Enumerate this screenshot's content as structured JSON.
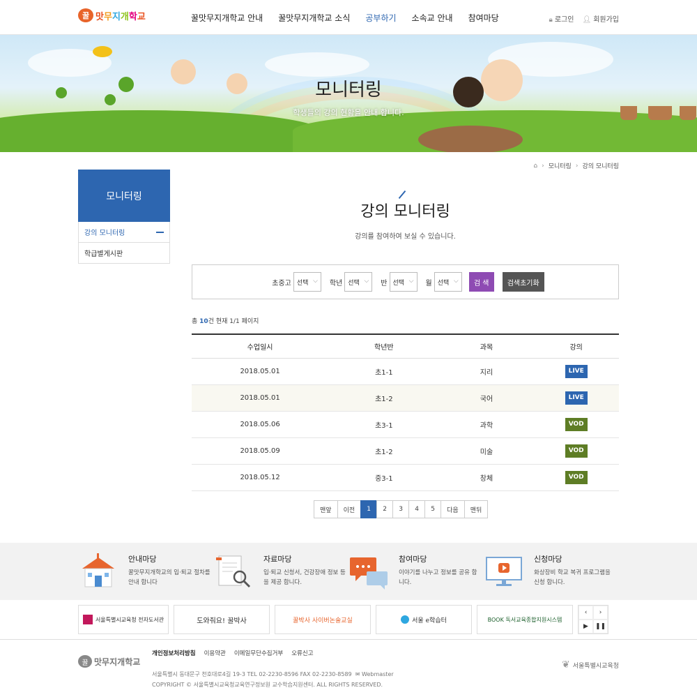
{
  "header": {
    "logo_badge": "꿀",
    "logo_chars": [
      "맛",
      "무",
      "지",
      "개",
      "학",
      "교",
      ""
    ],
    "nav": [
      "꿀맛무지개학교 안내",
      "꿀맛무지개학교 소식",
      "공부하기",
      "소속교 안내",
      "참여마당"
    ],
    "login": "로그인",
    "join": "회원가입"
  },
  "visual": {
    "title": "모니터링",
    "subtitle": "학생들의 강의 현황을 안내 합니다."
  },
  "breadcrumb": [
    "모니터링",
    "강의 모니터링"
  ],
  "lnb": {
    "title": "모니터링",
    "items": [
      "강의 모니터링",
      "학급별게시판"
    ]
  },
  "main": {
    "title": "강의 모니터링",
    "desc": "강의를 참여하여 보실 수 있습니다."
  },
  "search": {
    "labels": [
      "초중고",
      "학년",
      "반",
      "월"
    ],
    "select_value": "선택",
    "search_btn": "검 색",
    "reset_btn": "검색초기화"
  },
  "count": {
    "prefix": "총 ",
    "total": "10",
    "suffix": "건 현재 1/1 페이지"
  },
  "table": {
    "headers": [
      "수업일시",
      "학년반",
      "과목",
      "강의"
    ],
    "rows": [
      {
        "date": "2018.05.01",
        "class": "초1-1",
        "subject": "지리",
        "type": "LIVE"
      },
      {
        "date": "2018.05.01",
        "class": "초1-2",
        "subject": "국어",
        "type": "LIVE"
      },
      {
        "date": "2018.05.06",
        "class": "초3-1",
        "subject": "과학",
        "type": "VOD"
      },
      {
        "date": "2018.05.09",
        "class": "초1-2",
        "subject": "미술",
        "type": "VOD"
      },
      {
        "date": "2018.05.12",
        "class": "중3-1",
        "subject": "창체",
        "type": "VOD"
      }
    ]
  },
  "paging": [
    "맨앞",
    "이전",
    "1",
    "2",
    "3",
    "4",
    "5",
    "다음",
    "맨뒤"
  ],
  "footer_banners": [
    {
      "title": "안내마당",
      "desc": "꿀맛무지개학교의 입·퇴교 절차를 안내 합니다"
    },
    {
      "title": "자료마당",
      "desc": "입·퇴교 신청서, 건강장애 정보 등을 제공 합니다."
    },
    {
      "title": "참여마당",
      "desc": "이야기를 나누고 정보를 공유 합니다."
    },
    {
      "title": "신청마당",
      "desc": "화상장비 학교 복귀 프로그램을 신청 합니다."
    }
  ],
  "links": [
    "서울특별시교육청 전자도서관",
    "도와줘요! 꿀박사",
    "꿀박사 사이버논술교실",
    "서울 e학습터",
    "BOOK 독서교육종합지원시스템"
  ],
  "footer": {
    "menu": [
      "개인정보처리방침",
      "이용약관",
      "이메일무단수집거부",
      "오류신고"
    ],
    "address": "서울특별시 동대문구 천호대로4길 19-3   TEL 02-2230-8596   FAX 02-2230-8589",
    "webmaster": "Webmaster",
    "copyright": "COPYRIGHT © 서울특별시교육청교육연구정보원 교수학습지원센터.  ALL RIGHTS RESERVED.",
    "org": "서울특별시교육청"
  },
  "colors": {
    "primary": "#2d66b0",
    "search_btn": "#8e4bb3",
    "reset_btn": "#555555",
    "live": "#2d66b0",
    "vod": "#5e7d25"
  }
}
